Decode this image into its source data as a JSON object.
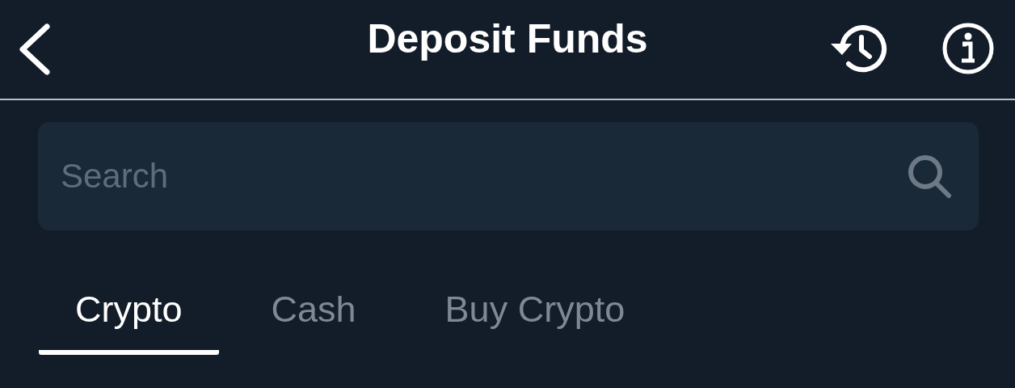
{
  "header": {
    "title": "Deposit Funds"
  },
  "search": {
    "placeholder": "Search"
  },
  "tabs": [
    {
      "label": "Crypto",
      "selected": true
    },
    {
      "label": "Cash",
      "selected": false
    },
    {
      "label": "Buy Crypto",
      "selected": false
    }
  ]
}
